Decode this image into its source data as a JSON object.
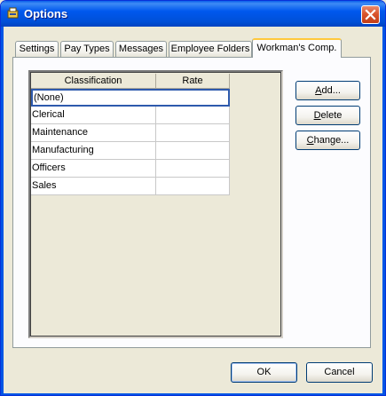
{
  "window": {
    "title": "Options",
    "icon": "app-icon"
  },
  "tabs": [
    {
      "label": "Settings",
      "active": false
    },
    {
      "label": "Pay Types",
      "active": false
    },
    {
      "label": "Messages",
      "active": false
    },
    {
      "label": "Employee Folders",
      "active": false
    },
    {
      "label": "Workman's Comp.",
      "active": true
    }
  ],
  "grid": {
    "columns": [
      "Classification",
      "Rate"
    ],
    "rows": [
      {
        "classification": "(None)",
        "rate": ""
      },
      {
        "classification": "Clerical",
        "rate": ""
      },
      {
        "classification": "Maintenance",
        "rate": ""
      },
      {
        "classification": "Manufacturing",
        "rate": ""
      },
      {
        "classification": "Officers",
        "rate": ""
      },
      {
        "classification": "Sales",
        "rate": ""
      }
    ]
  },
  "side_buttons": {
    "add": {
      "mnemonic": "A",
      "rest": "dd..."
    },
    "delete": {
      "mnemonic": "D",
      "rest": "elete"
    },
    "change": {
      "mnemonic": "C",
      "rest": "hange..."
    }
  },
  "footer": {
    "ok_label": "OK",
    "cancel_label": "Cancel"
  },
  "colors": {
    "titlebar": "#0058EE",
    "dialog_bg": "#ECE9D8",
    "active_tab_accent": "#FFC83C",
    "focus_border": "#2E5AAD"
  }
}
